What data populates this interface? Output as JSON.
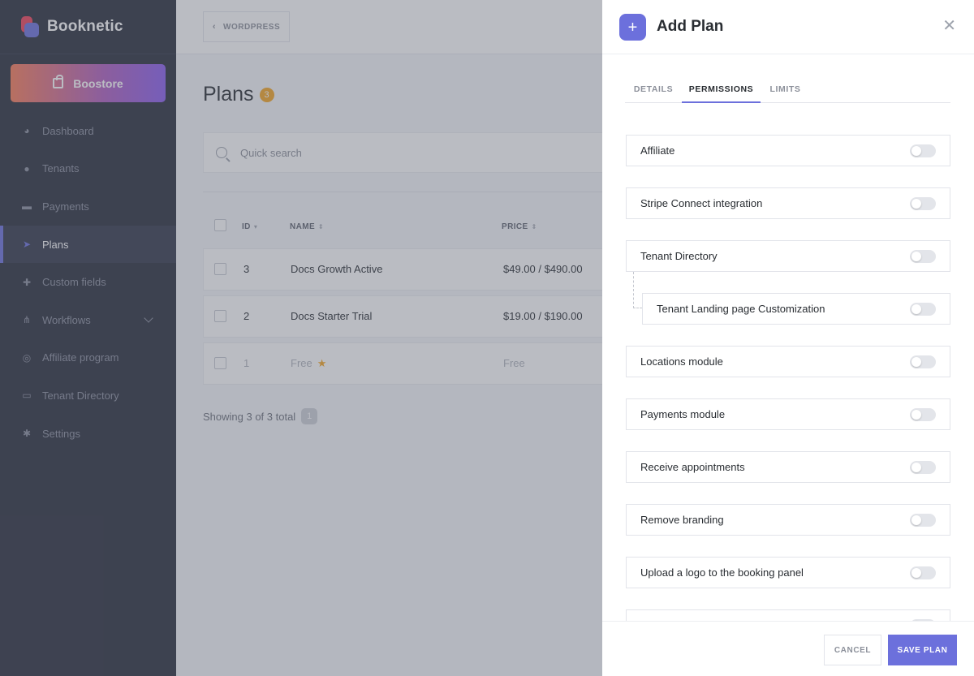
{
  "brand": {
    "name": "Booknetic"
  },
  "sidebar": {
    "boostore_label": "Boostore",
    "items": [
      {
        "label": "Dashboard",
        "icon": "dashboard-icon"
      },
      {
        "label": "Tenants",
        "icon": "user-icon"
      },
      {
        "label": "Payments",
        "icon": "credit-card-icon"
      },
      {
        "label": "Plans",
        "icon": "rocket-icon",
        "active": true
      },
      {
        "label": "Custom fields",
        "icon": "puzzle-icon"
      },
      {
        "label": "Workflows",
        "icon": "workflow-icon"
      },
      {
        "label": "Affiliate program",
        "icon": "target-icon"
      },
      {
        "label": "Tenant Directory",
        "icon": "laptop-icon"
      },
      {
        "label": "Settings",
        "icon": "gear-icon"
      }
    ]
  },
  "topbar": {
    "wordpress_label": "WORDPRESS"
  },
  "page": {
    "title": "Plans",
    "count": "3"
  },
  "search": {
    "placeholder": "Quick search"
  },
  "table": {
    "headers": {
      "id": "ID",
      "name": "NAME",
      "price": "PRICE"
    },
    "rows": [
      {
        "id": "3",
        "name": "Docs Growth Active",
        "price": "$49.00 / $490.00"
      },
      {
        "id": "2",
        "name": "Docs Starter Trial",
        "price": "$19.00 / $190.00"
      },
      {
        "id": "1",
        "name": "Free",
        "price": "Free",
        "default": true
      }
    ],
    "footer": "Showing 3 of 3 total",
    "page": "1"
  },
  "panel": {
    "title": "Add Plan",
    "tabs": [
      {
        "label": "DETAILS"
      },
      {
        "label": "PERMISSIONS",
        "active": true
      },
      {
        "label": "LIMITS"
      }
    ],
    "permissions": [
      {
        "label": "Affiliate",
        "enabled": false
      },
      {
        "label": "Stripe Connect integration",
        "enabled": false
      },
      {
        "label": "Tenant Directory",
        "enabled": false
      },
      {
        "label": "Tenant Landing page Customization",
        "enabled": false,
        "child": true
      },
      {
        "label": "Locations module",
        "enabled": false
      },
      {
        "label": "Payments module",
        "enabled": false
      },
      {
        "label": "Receive appointments",
        "enabled": false
      },
      {
        "label": "Remove branding",
        "enabled": false
      },
      {
        "label": "Upload a logo to the booking panel",
        "enabled": false
      }
    ],
    "cancel_label": "CANCEL",
    "save_label": "SAVE PLAN"
  },
  "colors": {
    "accent": "#6c70dc",
    "sidebar": "#292d3c",
    "badge": "#f5a623"
  }
}
